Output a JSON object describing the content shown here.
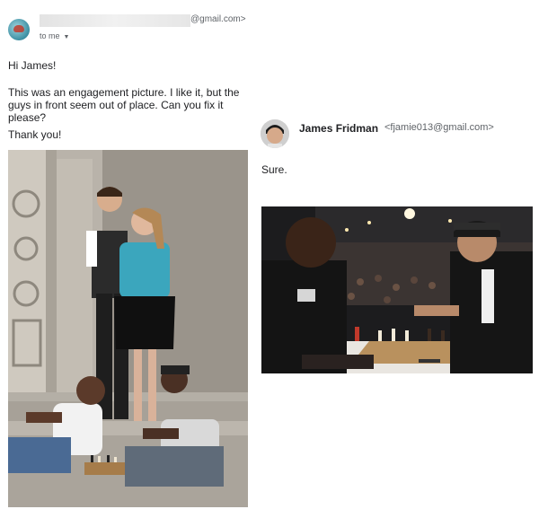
{
  "original_email": {
    "sender_domain": "@gmail.com>",
    "to_me_label": "to me",
    "greeting": "Hi James!",
    "message": "This was an engagement picture. I like it, but the guys in front seem out of place. Can you fix it please?",
    "sign_off": "Thank you!"
  },
  "reply": {
    "sender_name": "James Fridman",
    "sender_email": "<fjamie013@gmail.com>",
    "message": "Sure."
  },
  "colors": {
    "text": "#202124",
    "muted": "#5f6368",
    "wall": "#8f8a83"
  }
}
